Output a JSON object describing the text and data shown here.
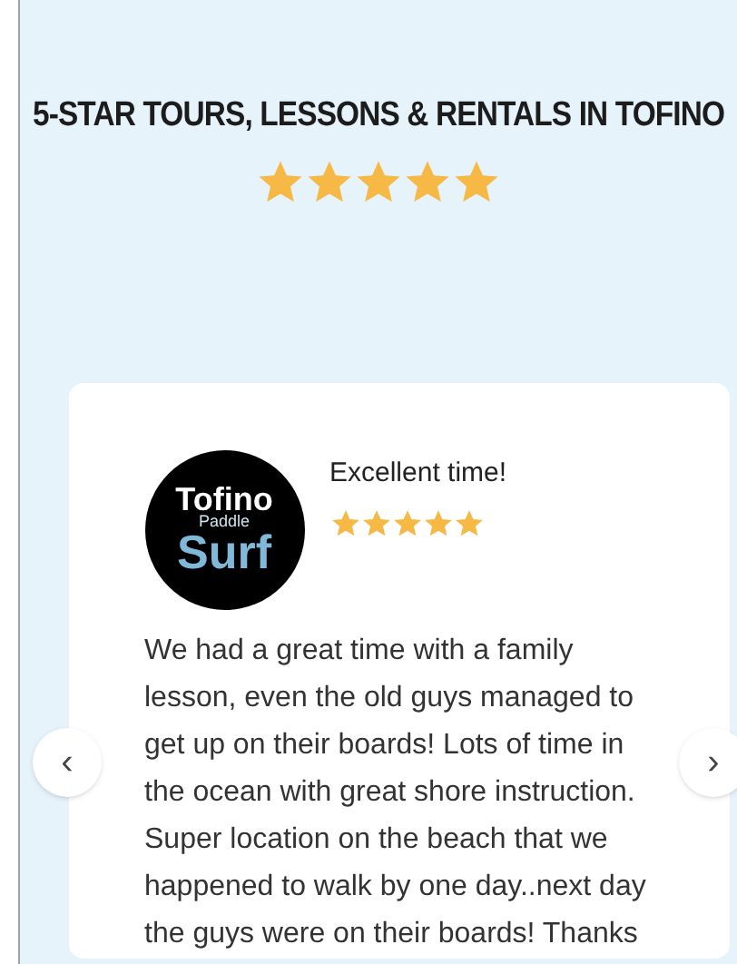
{
  "heading": {
    "text": "5-STAR TOURS, LESSONS & RENTALS IN TOFINO",
    "stars": 5
  },
  "review": {
    "logo": {
      "line_1": "Tofino",
      "line_2": "Paddle",
      "line_3": "Surf"
    },
    "title": "Excellent time!",
    "stars": 5,
    "text": "We had a great time with a family lesson, even the old guys managed to get up on their boards! Lots of time in the ocean with great shore instruction. Super location on the beach that we happened to walk by one day..next day the guys were on their boards! Thanks"
  },
  "nav": {
    "previous": "‹",
    "next": "›"
  }
}
